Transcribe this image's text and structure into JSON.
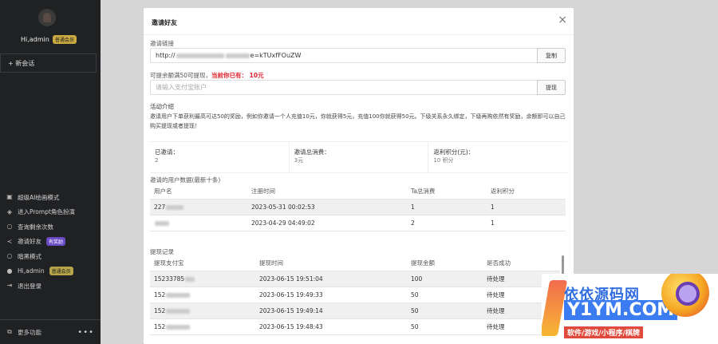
{
  "sidebar": {
    "username": "Hi,admin",
    "user_badge": "普通会员",
    "new_chat": "+ 新会话",
    "menu": [
      {
        "icon": "image-icon",
        "label": "超级AI绘画模式",
        "badge": ""
      },
      {
        "icon": "cube-icon",
        "label": "进入Prompt角色扮演",
        "badge": ""
      },
      {
        "icon": "circle-icon",
        "label": "查询剩余次数",
        "badge": ""
      },
      {
        "icon": "share-icon",
        "label": "邀请好友",
        "badge": "有奖励"
      },
      {
        "icon": "circle-icon",
        "label": "暗黑模式",
        "badge": ""
      },
      {
        "icon": "user-icon",
        "label": "Hi,admin",
        "badge": "普通会员"
      },
      {
        "icon": "logout-icon",
        "label": "退出登录",
        "badge": ""
      }
    ],
    "footer_label": "更多功能",
    "footer_more": "•••"
  },
  "modal": {
    "title": "邀请好友",
    "close": "×",
    "link_label": "邀请链接",
    "link_value_prefix": "http://",
    "link_value_suffix": "e=kTUxfFOuZW",
    "copy_button": "复制",
    "withdraw_label": "可提余额满50可提现，",
    "withdraw_current": "当前你已有： 10元",
    "withdraw_placeholder": "请输入支付宝账户",
    "withdraw_button": "提现",
    "activity_title": "活动介绍",
    "activity_text": "邀请用户下单获利最高可达50的奖励，例如你邀请一个人充值10元，你就获得5元，充值100你就获得50元。下级关系永久绑定，下级再购依然有奖励，余额即可以自己购买提现或者提现！",
    "stats": [
      {
        "label": "已邀请：",
        "value": "2"
      },
      {
        "label": "邀请总消费：",
        "value": "3元"
      },
      {
        "label": "返利积分(元)：",
        "value": "10 积分"
      }
    ],
    "invite_table_title": "邀请的用户数据(最新十条)",
    "invite_table": {
      "headers": [
        "用户名",
        "注册时间",
        "Ta总消费",
        "返利积分"
      ],
      "rows": [
        [
          "227",
          "2023-05-31 00:02:53",
          "1",
          "1"
        ],
        [
          "",
          "2023-04-29 04:49:02",
          "2",
          "1"
        ]
      ]
    },
    "withdraw_table_title": "提现记录",
    "withdraw_table": {
      "headers": [
        "提现支付宝",
        "提现时间",
        "提现金额",
        "是否成功"
      ],
      "rows": [
        [
          "15233785",
          "2023-06-15 19:51:04",
          "100",
          "待处理"
        ],
        [
          "152",
          "2023-06-15 19:49:33",
          "50",
          "待处理"
        ],
        [
          "152",
          "2023-06-15 19:49:14",
          "50",
          "待处理"
        ],
        [
          "152",
          "2023-06-15 19:48:43",
          "50",
          "待处理"
        ]
      ]
    }
  },
  "watermark": {
    "line1": "依依源码网",
    "line2": "Y1YM.COM",
    "line3": "软件/游戏/小程序/棋牌"
  },
  "colors": {
    "sidebar_bg": "#202123",
    "highlight_red": "#e0242f",
    "badge_gold": "#c9a940",
    "badge_purple": "#6a4bc4"
  }
}
